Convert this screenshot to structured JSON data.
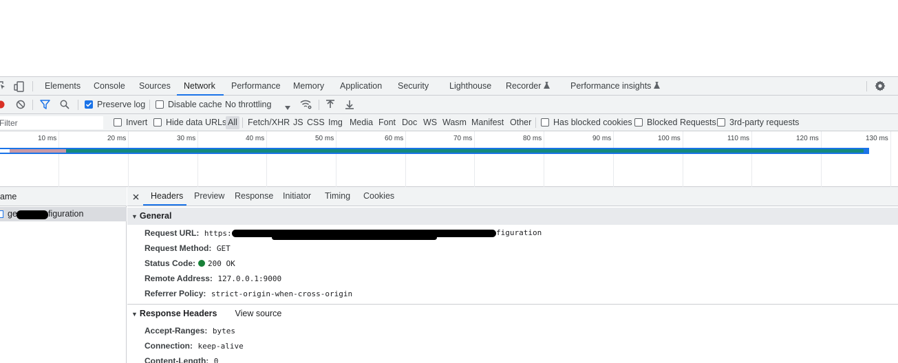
{
  "tabs": [
    {
      "label": "Elements"
    },
    {
      "label": "Console"
    },
    {
      "label": "Sources"
    },
    {
      "label": "Network",
      "active": true
    },
    {
      "label": "Performance"
    },
    {
      "label": "Memory"
    },
    {
      "label": "Application"
    },
    {
      "label": "Security"
    },
    {
      "label": "Lighthouse"
    },
    {
      "label": "Recorder",
      "experimental": true
    },
    {
      "label": "Performance insights",
      "experimental": true
    }
  ],
  "toolbar": {
    "preserve_log": {
      "label": "Preserve log",
      "checked": true
    },
    "disable_cache": {
      "label": "Disable cache",
      "checked": false
    },
    "throttling": "No throttling"
  },
  "filter": {
    "placeholder": "Filter",
    "invert": {
      "label": "Invert",
      "checked": false
    },
    "hide_data_urls": {
      "label": "Hide data URLs",
      "checked": false
    },
    "types": [
      "All",
      "Fetch/XHR",
      "JS",
      "CSS",
      "Img",
      "Media",
      "Font",
      "Doc",
      "WS",
      "Wasm",
      "Manifest",
      "Other"
    ],
    "active_type": "All",
    "has_blocked_cookies": {
      "label": "Has blocked cookies",
      "checked": false
    },
    "blocked_requests": {
      "label": "Blocked Requests",
      "checked": false
    },
    "third_party": {
      "label": "3rd-party requests",
      "checked": false
    }
  },
  "timeline": {
    "ticks": [
      "10 ms",
      "20 ms",
      "30 ms",
      "40 ms",
      "50 ms",
      "60 ms",
      "70 ms",
      "80 ms",
      "90 ms",
      "100 ms",
      "110 ms",
      "120 ms",
      "130 ms"
    ],
    "request_duration_ms": 125
  },
  "request_list": {
    "column_name": "ame",
    "rows": [
      {
        "name_start": "ge",
        "name_end": "figuration"
      }
    ]
  },
  "details": {
    "tabs": [
      "Headers",
      "Preview",
      "Response",
      "Initiator",
      "Timing",
      "Cookies"
    ],
    "active_tab": "Headers",
    "general": {
      "title": "General",
      "request_url": {
        "name": "Request URL:",
        "value_start": "https:",
        "value_end": "figuration"
      },
      "request_method": {
        "name": "Request Method:",
        "value": "GET"
      },
      "status_code": {
        "name": "Status Code:",
        "value": "200 OK"
      },
      "remote_address": {
        "name": "Remote Address:",
        "value": "127.0.0.1:9000"
      },
      "referrer_policy": {
        "name": "Referrer Policy:",
        "value": "strict-origin-when-cross-origin"
      }
    },
    "response_headers": {
      "title": "Response Headers",
      "view_source": "View source",
      "accept_ranges": {
        "name": "Accept-Ranges:",
        "value": "bytes"
      },
      "connection": {
        "name": "Connection:",
        "value": "keep-alive"
      },
      "content_length": {
        "name": "Content-Length:",
        "value": "0"
      }
    }
  },
  "colors": {
    "accent": "#1a73e8",
    "record": "#d93025",
    "status_ok": "#188038",
    "waterfall_bar": "#14897d"
  }
}
